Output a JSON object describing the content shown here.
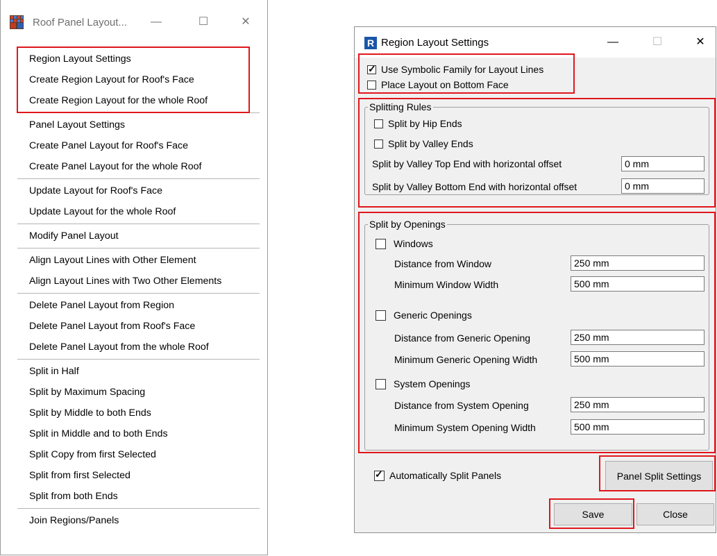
{
  "left_window": {
    "title": "Roof Panel Layout...",
    "controls": {
      "minimize": "—",
      "maximize": "☐",
      "close": "✕"
    },
    "groups": [
      [
        "Region Layout Settings",
        "Create Region Layout for Roof's Face",
        "Create Region Layout for the whole Roof"
      ],
      [
        "Panel Layout Settings",
        "Create Panel Layout for Roof's Face",
        "Create Panel Layout for the whole Roof"
      ],
      [
        "Update Layout for Roof's Face",
        "Update Layout for the whole Roof"
      ],
      [
        "Modify Panel Layout"
      ],
      [
        "Align Layout Lines with Other Element",
        "Align Layout Lines with Two Other Elements"
      ],
      [
        "Delete Panel Layout from Region",
        "Delete Panel Layout from Roof's Face",
        "Delete Panel Layout from the whole Roof"
      ],
      [
        "Split in Half",
        "Split by Maximum Spacing",
        "Split by Middle to both Ends",
        "Split in Middle and to both Ends",
        "Split Copy from first Selected",
        "Split from first Selected",
        "Split from both Ends"
      ],
      [
        "Join Regions/Panels"
      ]
    ]
  },
  "right_window": {
    "app_icon": "R",
    "title": "Region Layout Settings",
    "controls": {
      "minimize": "—",
      "maximize": "☐",
      "close": "✕"
    },
    "use_symbolic": {
      "label": "Use Symbolic Family for Layout Lines",
      "checked": true
    },
    "place_bottom": {
      "label": "Place Layout on Bottom Face",
      "checked": false
    },
    "splitting_rules": {
      "legend": "Splitting Rules",
      "hip_ends": {
        "label": "Split by Hip Ends",
        "checked": false
      },
      "valley_ends": {
        "label": "Split by Valley Ends",
        "checked": false
      },
      "valley_top_label": "Split by Valley Top End with horizontal offset",
      "valley_top_value": "0 mm",
      "valley_bottom_label": "Split by Valley Bottom End with horizontal offset",
      "valley_bottom_value": "0 mm"
    },
    "split_openings": {
      "legend": "Split by Openings",
      "windows": {
        "label": "Windows",
        "checked": false
      },
      "dist_window_label": "Distance from Window",
      "dist_window_value": "250 mm",
      "min_window_label": "Minimum Window Width",
      "min_window_value": "500 mm",
      "generic": {
        "label": "Generic Openings",
        "checked": false
      },
      "dist_generic_label": "Distance from Generic Opening",
      "dist_generic_value": "250 mm",
      "min_generic_label": "Minimum Generic Opening Width",
      "min_generic_value": "500 mm",
      "system": {
        "label": "System Openings",
        "checked": false
      },
      "dist_system_label": "Distance from System Opening",
      "dist_system_value": "250 mm",
      "min_system_label": "Minimum System Opening Width",
      "min_system_value": "500 mm"
    },
    "auto_split": {
      "label": "Automatically Split Panels",
      "checked": true
    },
    "panel_split_settings": "Panel Split Settings",
    "save": "Save",
    "close": "Close"
  },
  "colors": {
    "highlight": "#e0161c",
    "dialog_bg": "#f0f0f0",
    "revit_blue": "#1a56a8"
  }
}
